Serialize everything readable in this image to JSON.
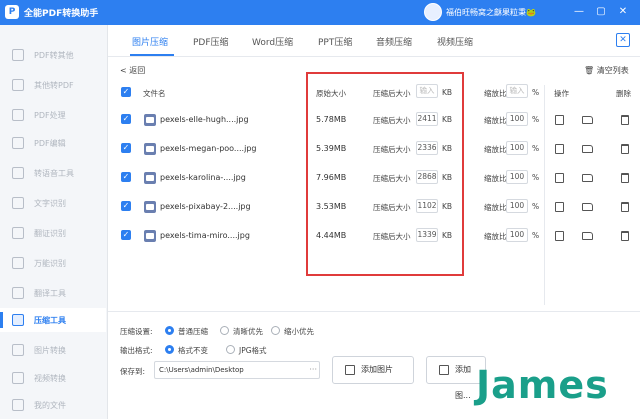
{
  "titlebar": {
    "logo": "P",
    "title": "全能PDF转换助手",
    "user_name": "福伯旺畅窝之龢果粒秉🐸",
    "minimize": "—",
    "maximize": "▢",
    "close": "✕"
  },
  "sidebar": {
    "items": [
      {
        "label": "PDF转其他"
      },
      {
        "label": "其他转PDF"
      },
      {
        "label": "PDF处理"
      },
      {
        "label": "PDF编辑"
      },
      {
        "label": "转语音工具"
      },
      {
        "label": "文字识别"
      },
      {
        "label": "翻证识别"
      },
      {
        "label": "万能识别"
      },
      {
        "label": "翻译工具"
      },
      {
        "label": "压缩工具"
      },
      {
        "label": "图片转换"
      },
      {
        "label": "视频转换"
      },
      {
        "label": "我的文件"
      }
    ],
    "active_index": 9
  },
  "tabs": [
    {
      "label": "图片压缩"
    },
    {
      "label": "PDF压缩"
    },
    {
      "label": "Word压缩"
    },
    {
      "label": "PPT压缩"
    },
    {
      "label": "音频压缩"
    },
    {
      "label": "视频压缩"
    }
  ],
  "tab_close": "✕",
  "toolbar": {
    "back": "< 返回",
    "clear": "清空列表"
  },
  "table": {
    "headers": {
      "file_name": "文件名",
      "original_size": "原始大小",
      "compressed_size": "压缩后大小",
      "compressed_placeholder": "输入",
      "kb": "KB",
      "scale": "缩放比",
      "scale_placeholder": "输入",
      "percent": "%",
      "action": "操作",
      "delete": "删除"
    },
    "rows": [
      {
        "name": "pexels-elle-hugh....jpg",
        "original": "5.78MB",
        "compressed_label": "压缩后大小",
        "compressed": "2411",
        "kb": "KB",
        "scale_label": "缩放比",
        "scale": "100",
        "percent": "%"
      },
      {
        "name": "pexels-megan-poo....jpg",
        "original": "5.39MB",
        "compressed_label": "压缩后大小",
        "compressed": "2336",
        "kb": "KB",
        "scale_label": "缩放比",
        "scale": "100",
        "percent": "%"
      },
      {
        "name": "pexels-karolina-....jpg",
        "original": "7.96MB",
        "compressed_label": "压缩后大小",
        "compressed": "2868",
        "kb": "KB",
        "scale_label": "缩放比",
        "scale": "100",
        "percent": "%"
      },
      {
        "name": "pexels-pixabay-2....jpg",
        "original": "3.53MB",
        "compressed_label": "压缩后大小",
        "compressed": "1102",
        "kb": "KB",
        "scale_label": "缩放比",
        "scale": "100",
        "percent": "%"
      },
      {
        "name": "pexels-tima-miro....jpg",
        "original": "4.44MB",
        "compressed_label": "压缩后大小",
        "compressed": "1339",
        "kb": "KB",
        "scale_label": "缩放比",
        "scale": "100",
        "percent": "%"
      }
    ]
  },
  "options": {
    "compress_label": "压缩设置:",
    "compress_choices": [
      "普通压缩",
      "清晰优先",
      "缩小优先"
    ],
    "format_label": "输出格式:",
    "format_choices": [
      "格式不变",
      "JPG格式"
    ]
  },
  "footer": {
    "save_label": "保存到:",
    "path": "C:\\Users\\admin\\Desktop",
    "path_more": "···",
    "add_image": "添加图片",
    "add_folder": "添加图..."
  },
  "watermark": "James",
  "colors": {
    "accent": "#2d7ff0",
    "highlight_box": "#e03b3b",
    "watermark": "#1a9f8a"
  }
}
